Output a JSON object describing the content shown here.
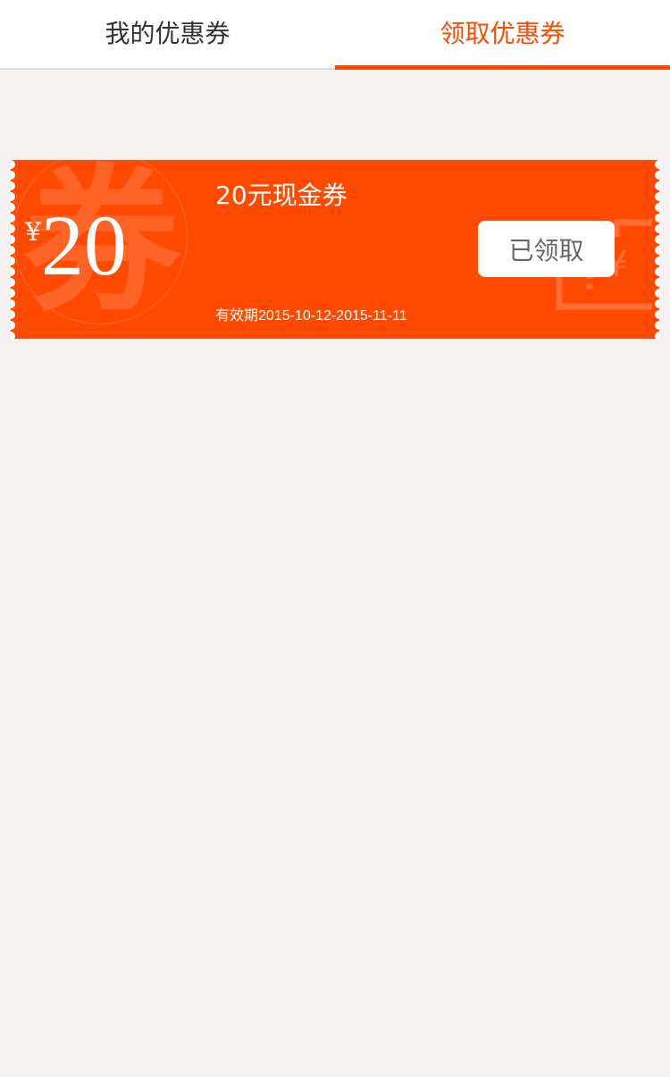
{
  "tabs": [
    {
      "label": "我的优惠券",
      "active": false
    },
    {
      "label": "领取优惠券",
      "active": true
    }
  ],
  "coupon": {
    "currency": "¥",
    "amount": "20",
    "title": "20元现金券",
    "validity": "有效期2015-10-12-2015-11-11",
    "button_label": "已领取",
    "background_char": "券",
    "wallet_currency": "¥"
  },
  "colors": {
    "accent": "#ff4a00",
    "page_background": "#f3f2f0"
  }
}
